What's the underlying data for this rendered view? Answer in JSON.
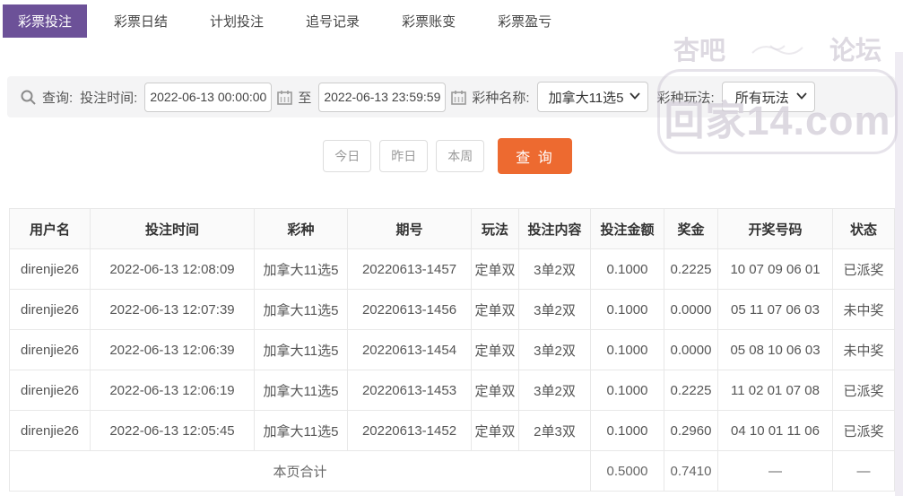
{
  "nav": {
    "tabs": [
      {
        "label": "彩票投注",
        "active": true
      },
      {
        "label": "彩票日结",
        "active": false
      },
      {
        "label": "计划投注",
        "active": false
      },
      {
        "label": "追号记录",
        "active": false
      },
      {
        "label": "彩票账变",
        "active": false
      },
      {
        "label": "彩票盈亏",
        "active": false
      }
    ]
  },
  "watermark": {
    "left": "杏吧",
    "right": "论坛",
    "bottom": "回家14.com"
  },
  "search": {
    "query_label": "查询:",
    "time_label": "投注时间:",
    "start_time": "2022-06-13 00:00:00",
    "to_label": "至",
    "end_time": "2022-06-13 23:59:59",
    "lottery_label": "彩种名称:",
    "lottery_value": "加拿大11选5",
    "play_label": "彩种玩法:",
    "play_value": "所有玩法"
  },
  "actions": {
    "today": "今日",
    "yesterday": "昨日",
    "this_week": "本周",
    "query": "查 询"
  },
  "colors": {
    "active_tab": "#6c5198",
    "primary_button": "#ed6a30",
    "status_paid": "#ed7045",
    "status_lost": "#bcbcbc"
  },
  "table": {
    "headers": [
      "用户名",
      "投注时间",
      "彩种",
      "期号",
      "玩法",
      "投注内容",
      "投注金额",
      "奖金",
      "开奖号码",
      "状态"
    ],
    "rows": [
      {
        "username": "direnjie26",
        "time": "2022-06-13 12:08:09",
        "lottery": "加拿大11选5",
        "issue": "20220613-1457",
        "play": "定单双",
        "content": "3单2双",
        "amount": "0.1000",
        "prize": "0.2225",
        "numbers": "10 07 09 06 01",
        "status": "已派奖",
        "status_type": "paid"
      },
      {
        "username": "direnjie26",
        "time": "2022-06-13 12:07:39",
        "lottery": "加拿大11选5",
        "issue": "20220613-1456",
        "play": "定单双",
        "content": "3单2双",
        "amount": "0.1000",
        "prize": "0.0000",
        "numbers": "05 11 07 06 03",
        "status": "未中奖",
        "status_type": "lost"
      },
      {
        "username": "direnjie26",
        "time": "2022-06-13 12:06:39",
        "lottery": "加拿大11选5",
        "issue": "20220613-1454",
        "play": "定单双",
        "content": "3单2双",
        "amount": "0.1000",
        "prize": "0.0000",
        "numbers": "05 08 10 06 03",
        "status": "未中奖",
        "status_type": "lost"
      },
      {
        "username": "direnjie26",
        "time": "2022-06-13 12:06:19",
        "lottery": "加拿大11选5",
        "issue": "20220613-1453",
        "play": "定单双",
        "content": "3单2双",
        "amount": "0.1000",
        "prize": "0.2225",
        "numbers": "11 02 01 07 08",
        "status": "已派奖",
        "status_type": "paid"
      },
      {
        "username": "direnjie26",
        "time": "2022-06-13 12:05:45",
        "lottery": "加拿大11选5",
        "issue": "20220613-1452",
        "play": "定单双",
        "content": "2单3双",
        "amount": "0.1000",
        "prize": "0.2960",
        "numbers": "04 10 01 11 06",
        "status": "已派奖",
        "status_type": "paid"
      }
    ],
    "summary": {
      "label": "本页合计",
      "amount": "0.5000",
      "prize": "0.7410",
      "numbers": "—",
      "status": "—"
    }
  }
}
